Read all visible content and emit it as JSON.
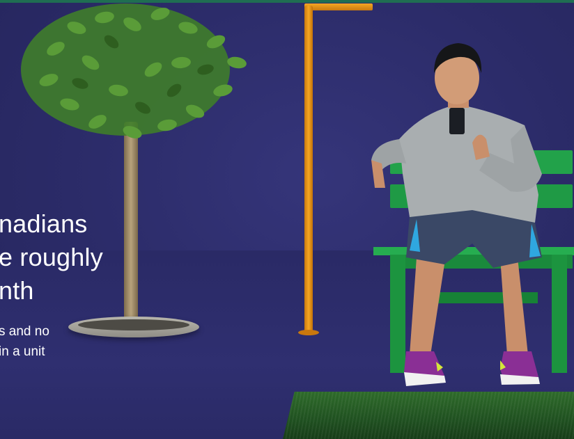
{
  "hero": {
    "headline_lines": [
      "nadians",
      "e roughly",
      "nth"
    ],
    "subtext_lines": [
      "s and no",
      "in a unit"
    ]
  },
  "colors": {
    "background": "#2c2c6b",
    "bench": "#22a24a",
    "lamp": "#f5a623",
    "top_bar": "#1f6e52"
  }
}
